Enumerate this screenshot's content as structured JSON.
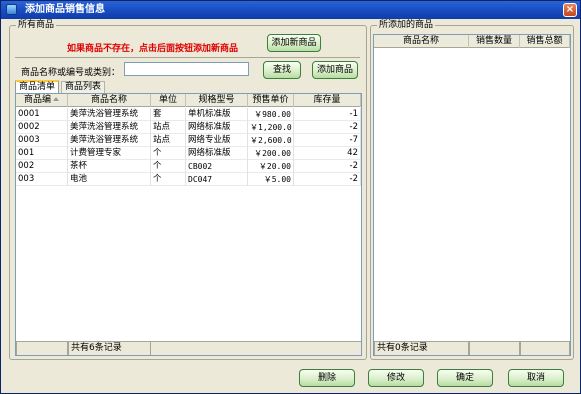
{
  "window": {
    "title": "添加商品销售信息",
    "close_label": "×"
  },
  "left_group": {
    "title": "所有商品",
    "warning": "如果商品不存在，点击后面按钮添加新商品",
    "add_new_button": "添加新商品",
    "search_label": "商品名称或编号或类别：",
    "search_value": "",
    "find_button": "查找",
    "add_goods_button": "添加商品",
    "tabs": [
      "商品清单",
      "商品列表"
    ],
    "columns": [
      "商品编",
      "商品名称",
      "单位",
      "规格型号",
      "预售单价",
      "库存量"
    ],
    "rows": [
      [
        "0001",
        "美萍洗浴管理系统",
        "套",
        "单机标准版",
        "￥980.00",
        "-1"
      ],
      [
        "0002",
        "美萍洗浴管理系统",
        "站点",
        "网络标准版",
        "￥1,200.0",
        "-2"
      ],
      [
        "0003",
        "美萍洗浴管理系统",
        "站点",
        "网络专业版",
        "￥2,600.0",
        "-7"
      ],
      [
        "001",
        "计费管理专家",
        "个",
        "网络标准版",
        "￥200.00",
        "42"
      ],
      [
        "002",
        "茶杯",
        "个",
        "CB002",
        "￥20.00",
        "-2"
      ],
      [
        "003",
        "电池",
        "个",
        "DC047",
        "￥5.00",
        "-2"
      ]
    ],
    "footer": "共有6条记录"
  },
  "right_group": {
    "title": "所添加的商品",
    "columns": [
      "商品名称",
      "销售数量",
      "销售总额"
    ],
    "footer": "共有0条记录"
  },
  "buttons": {
    "delete": "删除",
    "edit": "修改",
    "ok": "确定",
    "cancel": "取消"
  }
}
